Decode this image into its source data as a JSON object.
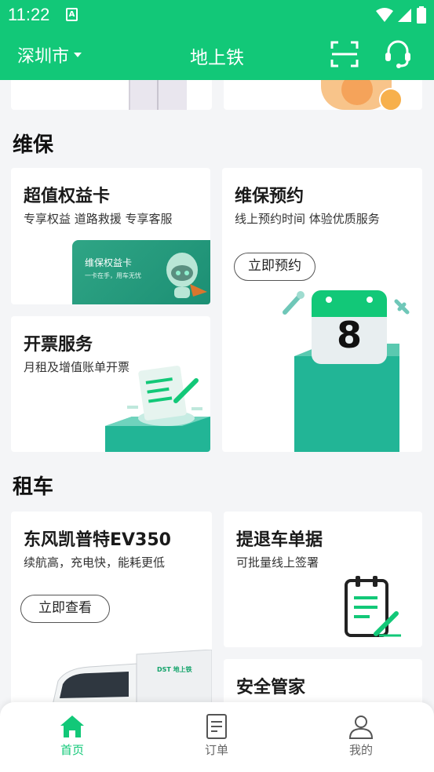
{
  "status_bar": {
    "time": "11:22",
    "app_icon_letter": "A"
  },
  "header": {
    "city": "深圳市",
    "title": "地上铁"
  },
  "sections": {
    "maintenance": {
      "title": "维保",
      "card_benefit": {
        "title": "超值权益卡",
        "subtitle": "专享权益 道路救援 专享客服",
        "art_title": "维保权益卡",
        "art_sub": "一卡在手，用车无忧"
      },
      "card_booking": {
        "title": "维保预约",
        "subtitle": "线上预约时间 体验优质服务",
        "button": "立即预约",
        "calendar_number": "8"
      },
      "card_invoice": {
        "title": "开票服务",
        "subtitle": "月租及增值账单开票"
      }
    },
    "rental": {
      "title": "租车",
      "card_vehicle": {
        "title": "东风凯普特EV350",
        "subtitle": "续航高，充电快，能耗更低",
        "button": "立即查看",
        "truck_brand": "DST 地上铁"
      },
      "card_return": {
        "title": "提退车单据",
        "subtitle": "可批量线上签署"
      },
      "card_safety": {
        "title": "安全管家"
      }
    }
  },
  "tabbar": {
    "home": "首页",
    "orders": "订单",
    "mine": "我的"
  },
  "colors": {
    "primary": "#12c878",
    "teal": "#1fb59a",
    "teal_dark": "#159e86"
  }
}
